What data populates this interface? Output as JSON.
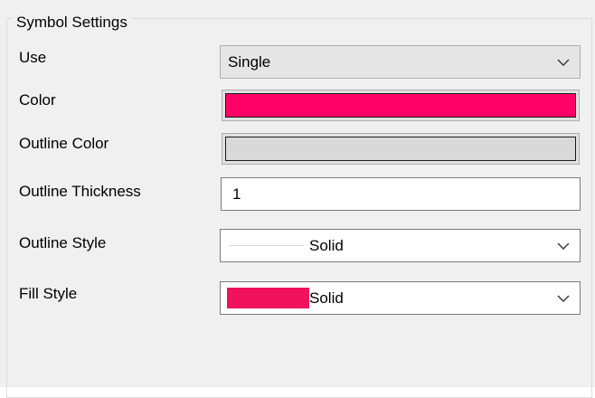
{
  "group": {
    "title": "Symbol Settings"
  },
  "use": {
    "label": "Use",
    "value": "Single"
  },
  "color": {
    "label": "Color",
    "swatch": "#ff0066"
  },
  "outline_color": {
    "label": "Outline Color",
    "swatch": "#d9d9d9"
  },
  "outline_thickness": {
    "label": "Outline Thickness",
    "value": "1"
  },
  "outline_style": {
    "label": "Outline Style",
    "value": "Solid",
    "line_color": "#d7d7d7"
  },
  "fill_style": {
    "label": "Fill Style",
    "value": "Solid",
    "swatch": "#f0125c"
  },
  "icons": {
    "dropdown": "chevron-down-icon"
  }
}
